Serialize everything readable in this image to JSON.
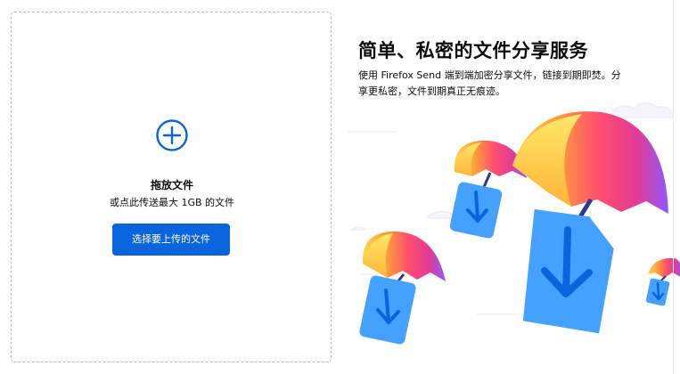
{
  "upload": {
    "icon": "add-circle-icon",
    "title": "拖放文件",
    "subtitle": "或点此传送最大 1GB 的文件",
    "button_label": "选择要上传的文件"
  },
  "intro": {
    "headline": "简单、私密的文件分享服务",
    "description": "使用 Firefox Send 端到端加密分享文件，链接到期即焚。分享更私密，文件到期真正无痕迹。"
  },
  "illustration": {
    "icon": "parachute-download-icon"
  },
  "colors": {
    "accent": "#0a64dc",
    "text": "#0c0c0d",
    "drop_border": "#b8b8c0",
    "parcel_blue": "#45a1ff",
    "arrow_blue": "#0a64dc"
  }
}
